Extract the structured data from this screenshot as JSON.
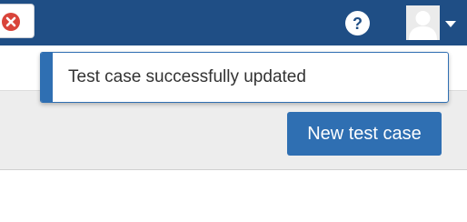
{
  "header": {
    "close_icon": "close-icon",
    "help_icon": "help-icon",
    "help_glyph": "?",
    "avatar_icon": "user-avatar-icon",
    "caret_icon": "chevron-down-icon",
    "background_color": "#1f4e85"
  },
  "notification": {
    "message": "Test case successfully updated",
    "accent_color": "#2f6fb2"
  },
  "toolbar": {
    "new_test_case_label": "New test case",
    "button_color": "#2f6fb2"
  }
}
